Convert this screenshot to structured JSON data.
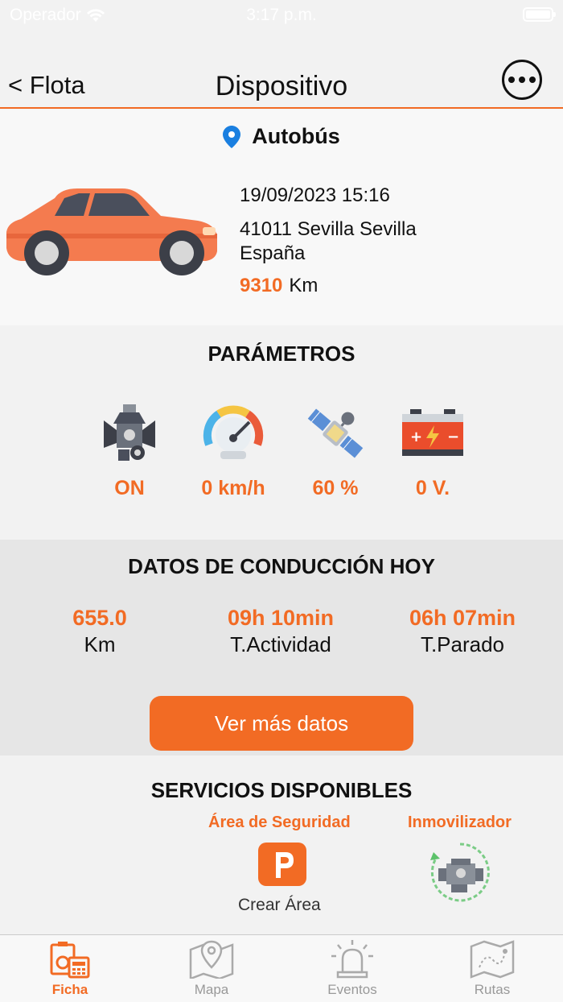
{
  "status_bar": {
    "carrier": "Operador",
    "time": "3:17 p.m."
  },
  "nav": {
    "back_label": "< Flota",
    "title": "Dispositivo"
  },
  "vehicle": {
    "name": "Autobús",
    "datetime": "19/09/2023 15:16",
    "address_line1": "41011 Sevilla Sevilla",
    "address_line2": "España",
    "km_value": "9310",
    "km_unit": "Km"
  },
  "parameters": {
    "title": "PARÁMETROS",
    "items": [
      {
        "icon": "engine-icon",
        "value": "ON"
      },
      {
        "icon": "speedometer-icon",
        "value": "0 km/h"
      },
      {
        "icon": "satellite-icon",
        "value": "60 %"
      },
      {
        "icon": "battery-icon",
        "value": "0 V."
      }
    ]
  },
  "driving": {
    "title": "DATOS DE CONDUCCIÓN HOY",
    "stats": [
      {
        "value": "655.0",
        "label": "Km"
      },
      {
        "value": "09h 10min",
        "label": "T.Actividad"
      },
      {
        "value": "06h 07min",
        "label": "T.Parado"
      }
    ],
    "more_button": "Ver más datos"
  },
  "services": {
    "title": "SERVICIOS DISPONIBLES",
    "security_area": {
      "label": "Área de Seguridad",
      "caption": "Crear Área"
    },
    "immobilizer": {
      "label": "Inmovilizador"
    }
  },
  "tabs": [
    {
      "label": "Ficha",
      "active": true
    },
    {
      "label": "Mapa",
      "active": false
    },
    {
      "label": "Eventos",
      "active": false
    },
    {
      "label": "Rutas",
      "active": false
    }
  ],
  "colors": {
    "accent": "#f26b24",
    "car": "#f47b4f"
  }
}
